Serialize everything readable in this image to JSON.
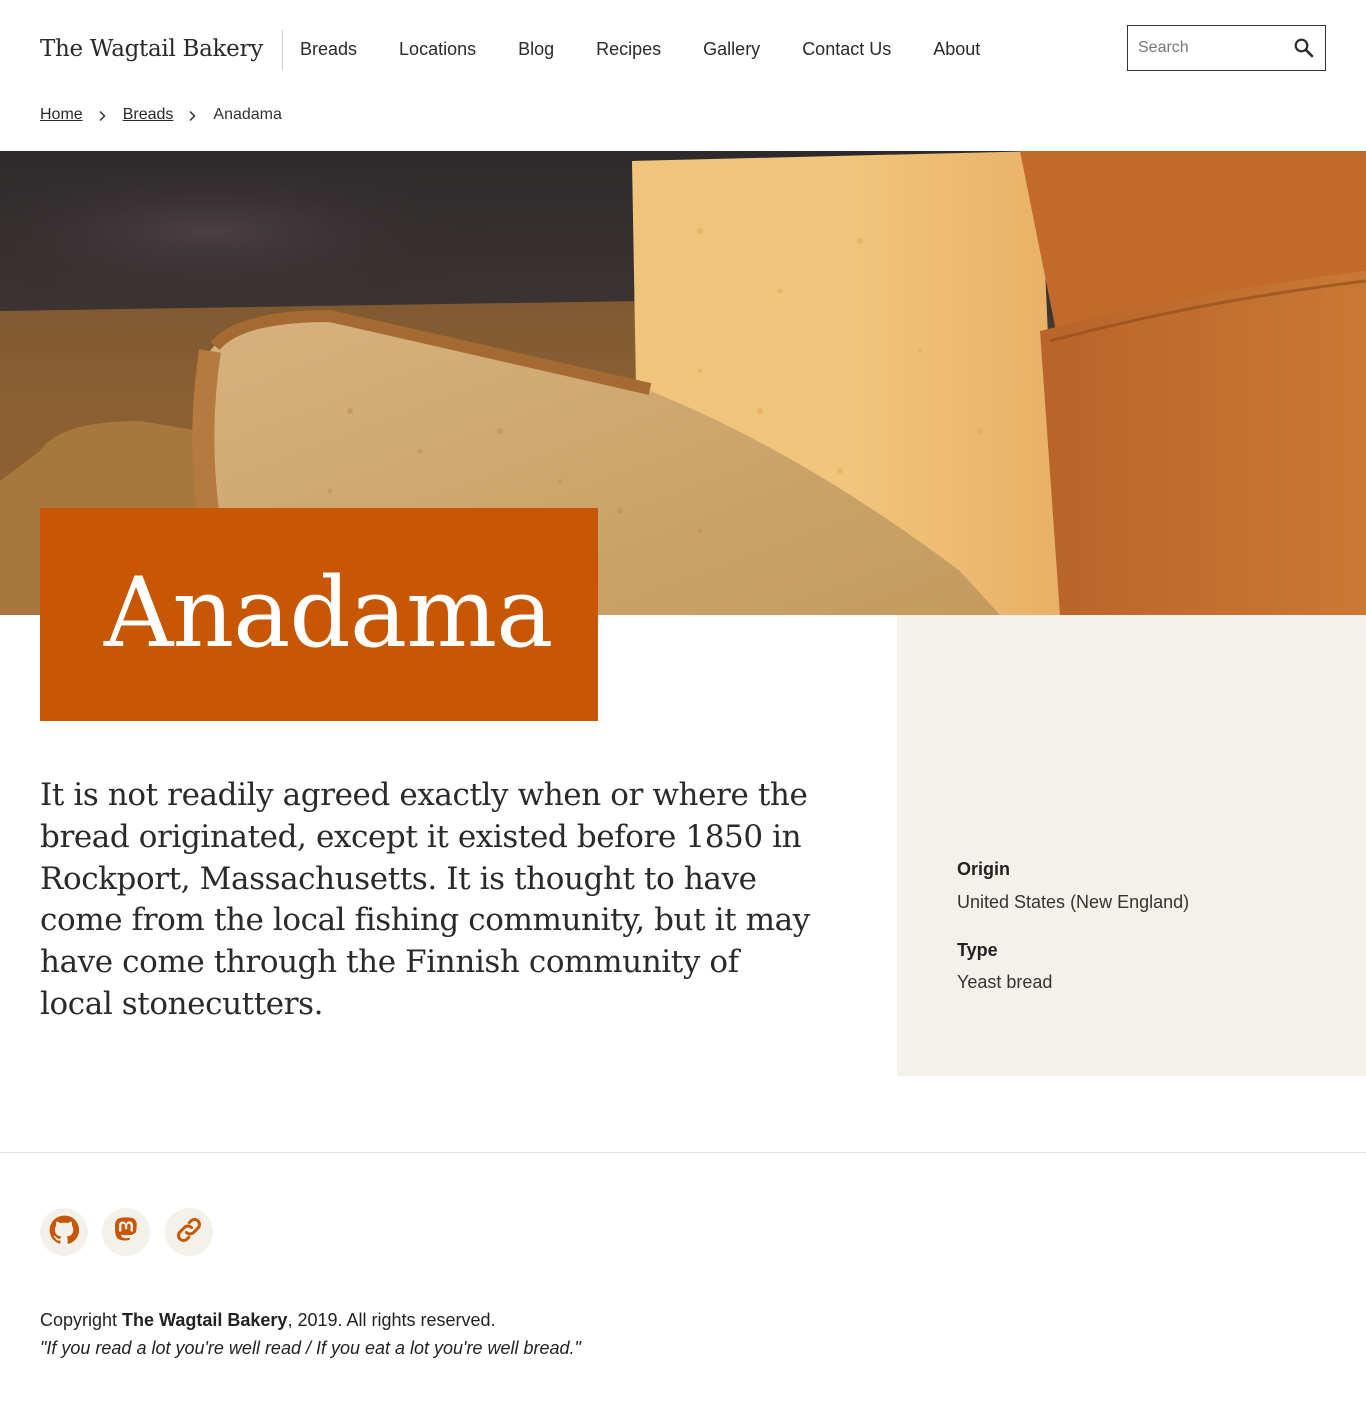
{
  "site": {
    "name": "The Wagtail Bakery"
  },
  "nav": {
    "items": [
      {
        "label": "Breads"
      },
      {
        "label": "Locations"
      },
      {
        "label": "Blog"
      },
      {
        "label": "Recipes"
      },
      {
        "label": "Gallery"
      },
      {
        "label": "Contact Us"
      },
      {
        "label": "About"
      }
    ]
  },
  "search": {
    "placeholder": "Search",
    "value": "",
    "icon": "search-icon"
  },
  "breadcrumb": {
    "items": [
      {
        "label": "Home"
      },
      {
        "label": "Breads"
      }
    ],
    "current": "Anadama"
  },
  "page": {
    "title": "Anadama",
    "intro": "It is not readily agreed exactly when or where the bread originated, except it existed before 1850 in Rockport, Massachusetts. It is thought to have come from the local fishing community, but it may have come through the Finnish community of local stonecutters.",
    "accent_color": "#c75605"
  },
  "details": {
    "origin_label": "Origin",
    "origin_value": "United States (New England)",
    "type_label": "Type",
    "type_value": "Yeast bread"
  },
  "footer": {
    "social": [
      {
        "icon": "github-icon"
      },
      {
        "icon": "mastodon-icon"
      },
      {
        "icon": "link-icon"
      }
    ],
    "copyright_prefix": "Copyright ",
    "copyright_name": "The Wagtail Bakery",
    "copyright_suffix": ", 2019. All rights reserved.",
    "tagline": "\"If you read a lot you're well read / If you eat a lot you're well bread.\""
  }
}
